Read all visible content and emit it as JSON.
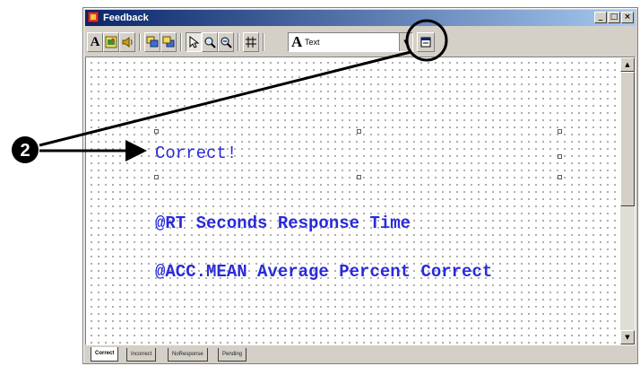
{
  "window": {
    "title": "Feedback"
  },
  "caption_buttons": {
    "minimize": "_",
    "maximize": "□",
    "close": "×"
  },
  "toolbar": {
    "text_tool_glyph": "A",
    "font_select": {
      "glyph": "A",
      "value": "Text"
    }
  },
  "annotation": {
    "step_number": "2"
  },
  "canvas": {
    "texts": [
      {
        "label": "Correct!"
      },
      {
        "label": "@RT Seconds Response Time"
      },
      {
        "label": "@ACC.MEAN Average Percent Correct"
      }
    ]
  },
  "tabs": [
    {
      "label": "Correct"
    },
    {
      "label": "Incorrect"
    },
    {
      "label": "NoResponse"
    },
    {
      "label": "Pending"
    }
  ],
  "colors": {
    "feedback_text": "#2a2adb",
    "title_bar": "#0a246a"
  }
}
